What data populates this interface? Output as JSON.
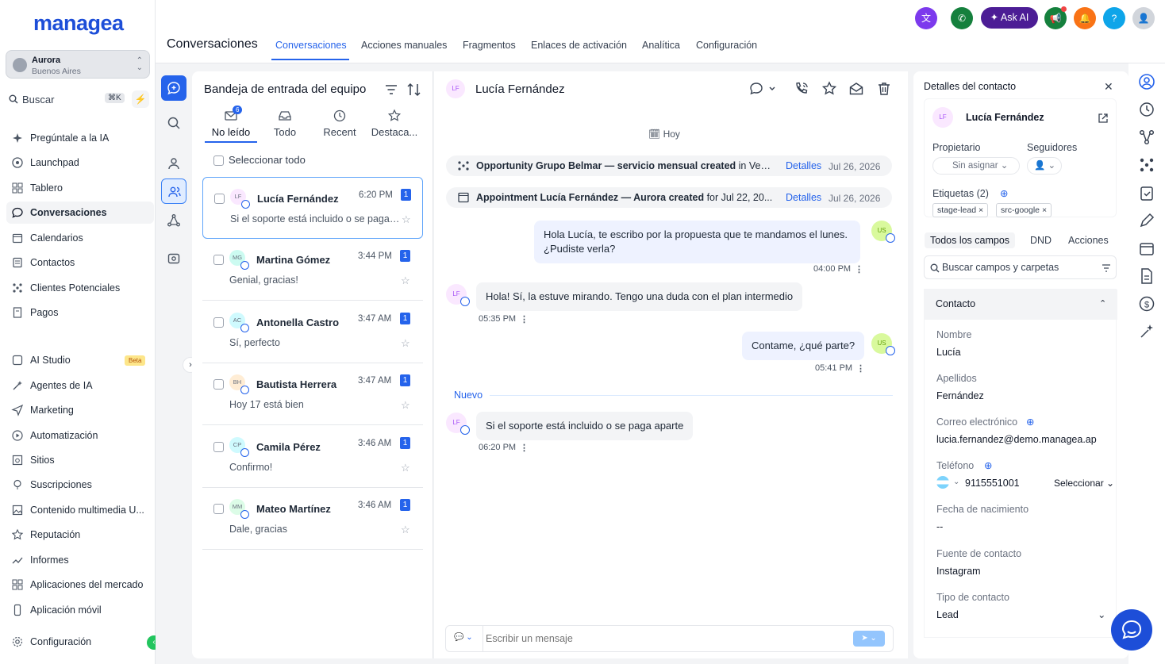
{
  "app": {
    "logo": "managea"
  },
  "location": {
    "name": "Aurora",
    "sub": "Buenos Aires"
  },
  "search": {
    "label": "Buscar",
    "shortcut": "⌘K"
  },
  "sidebar": {
    "items": [
      {
        "label": "Pregúntale a la IA",
        "icon": "sparkle-icon"
      },
      {
        "label": "Launchpad",
        "icon": "rocket-icon"
      },
      {
        "label": "Tablero",
        "icon": "grid-icon"
      },
      {
        "label": "Conversaciones",
        "icon": "chat-bubble-icon"
      },
      {
        "label": "Calendarios",
        "icon": "calendar-icon"
      },
      {
        "label": "Contactos",
        "icon": "contacts-icon"
      },
      {
        "label": "Clientes Potenciales",
        "icon": "pipeline-icon"
      },
      {
        "label": "Pagos",
        "icon": "receipt-icon"
      },
      {
        "label": "AI Studio",
        "icon": "ai-studio-icon",
        "badge": "Beta"
      },
      {
        "label": "Agentes de IA",
        "icon": "magic-wand-icon"
      },
      {
        "label": "Marketing",
        "icon": "send-icon"
      },
      {
        "label": "Automatización",
        "icon": "automation-icon"
      },
      {
        "label": "Sitios",
        "icon": "website-icon"
      },
      {
        "label": "Suscripciones",
        "icon": "membership-icon"
      },
      {
        "label": "Contenido multimedia U...",
        "icon": "image-icon"
      },
      {
        "label": "Reputación",
        "icon": "star-icon"
      },
      {
        "label": "Informes",
        "icon": "trend-icon"
      },
      {
        "label": "Aplicaciones del mercado",
        "icon": "apps-icon"
      },
      {
        "label": "Aplicación móvil",
        "icon": "mobile-icon"
      },
      {
        "label": "Configuración",
        "icon": "gear-icon"
      }
    ]
  },
  "header": {
    "title": "Conversaciones",
    "tabs": [
      "Conversaciones",
      "Acciones manuales",
      "Fragmentos",
      "Enlaces de activación",
      "Analítica",
      "Configuración"
    ],
    "ask_ai": "Ask AI"
  },
  "inbox": {
    "title": "Bandeja de entrada del equipo",
    "tabs": [
      {
        "label": "No leído",
        "badge": "6"
      },
      {
        "label": "Todo"
      },
      {
        "label": "Recent"
      },
      {
        "label": "Destaca..."
      }
    ],
    "select_all": "Seleccionar todo",
    "conversations": [
      {
        "initials": "LF",
        "name": "Lucía Fernández",
        "time": "6:20 PM",
        "unread": "1",
        "preview": "Si el soporte está incluido o se paga aparte",
        "avatar_bg": "#fae8ff"
      },
      {
        "initials": "MG",
        "name": "Martina Gómez",
        "time": "3:44 PM",
        "unread": "1",
        "preview": "Genial, gracias!",
        "avatar_bg": "#ccfbf1"
      },
      {
        "initials": "AC",
        "name": "Antonella Castro",
        "time": "3:47 AM",
        "unread": "1",
        "preview": "Sí, perfecto",
        "avatar_bg": "#cffafe"
      },
      {
        "initials": "BH",
        "name": "Bautista Herrera",
        "time": "3:47 AM",
        "unread": "1",
        "preview": "Hoy 17 está bien",
        "avatar_bg": "#ffedd5"
      },
      {
        "initials": "CP",
        "name": "Camila Pérez",
        "time": "3:46 AM",
        "unread": "1",
        "preview": "Confirmo!",
        "avatar_bg": "#cffafe"
      },
      {
        "initials": "MM",
        "name": "Mateo Martínez",
        "time": "3:46 AM",
        "unread": "1",
        "preview": "Dale, gracias",
        "avatar_bg": "#dcfce7"
      }
    ]
  },
  "chat": {
    "contact_initials": "LF",
    "contact_name": "Lucía Fernández",
    "day": "Hoy",
    "events": [
      {
        "bold": "Opportunity Grupo Belmar — servicio mensual created",
        "rest": " in Vent...",
        "link": "Detalles",
        "date": "Jul 26, 2026"
      },
      {
        "bold": "Appointment Lucía Fernández — Aurora created",
        "rest": " for Jul 22, 20...",
        "link": "Detalles",
        "date": "Jul 26, 2026"
      }
    ],
    "messages": [
      {
        "dir": "out",
        "line1": "Hola Lucía, te escribo por la propuesta que te mandamos el lunes.",
        "line2": "¿Pudiste verla?",
        "time": "04:00 PM",
        "initials": "US"
      },
      {
        "dir": "in",
        "text": "Hola! Sí, la estuve mirando. Tengo una duda con el plan intermedio",
        "time": "05:35 PM",
        "initials": "LF"
      },
      {
        "dir": "out",
        "text": "Contame, ¿qué parte?",
        "time": "05:41 PM",
        "initials": "US"
      },
      {
        "dir": "in",
        "text": "Si el soporte está incluido o se paga aparte",
        "time": "06:20 PM",
        "initials": "LF"
      }
    ],
    "new_divider": "Nuevo",
    "composer_placeholder": "Escribir un mensaje"
  },
  "contact": {
    "panel_title": "Detalles del contacto",
    "initials": "LF",
    "name": "Lucía Fernández",
    "owner_label": "Propietario",
    "owner_value": "Sin asignar",
    "followers_label": "Seguidores",
    "tags_label": "Etiquetas (2)",
    "tags": [
      "stage-lead",
      "src-google"
    ],
    "tabs": [
      "Todos los campos",
      "DND",
      "Acciones"
    ],
    "search_placeholder": "Buscar campos y carpetas",
    "section_title": "Contacto",
    "fields": [
      {
        "label": "Nombre",
        "value": "Lucía"
      },
      {
        "label": "Apellidos",
        "value": "Fernández"
      },
      {
        "label": "Correo electrónico",
        "value": "lucia.fernandez@demo.managea.ap"
      },
      {
        "label": "Teléfono",
        "value": "9115551001",
        "action": "Seleccionar"
      },
      {
        "label": "Fecha de nacimiento",
        "value": "--"
      },
      {
        "label": "Fuente de contacto",
        "value": "Instagram"
      },
      {
        "label": "Tipo de contacto",
        "value": "Lead"
      }
    ]
  },
  "colors": {
    "accent": "#2563eb",
    "brand": "#1d4ed8",
    "ask_ai": "#4c1d95",
    "success": "#22c55e"
  }
}
